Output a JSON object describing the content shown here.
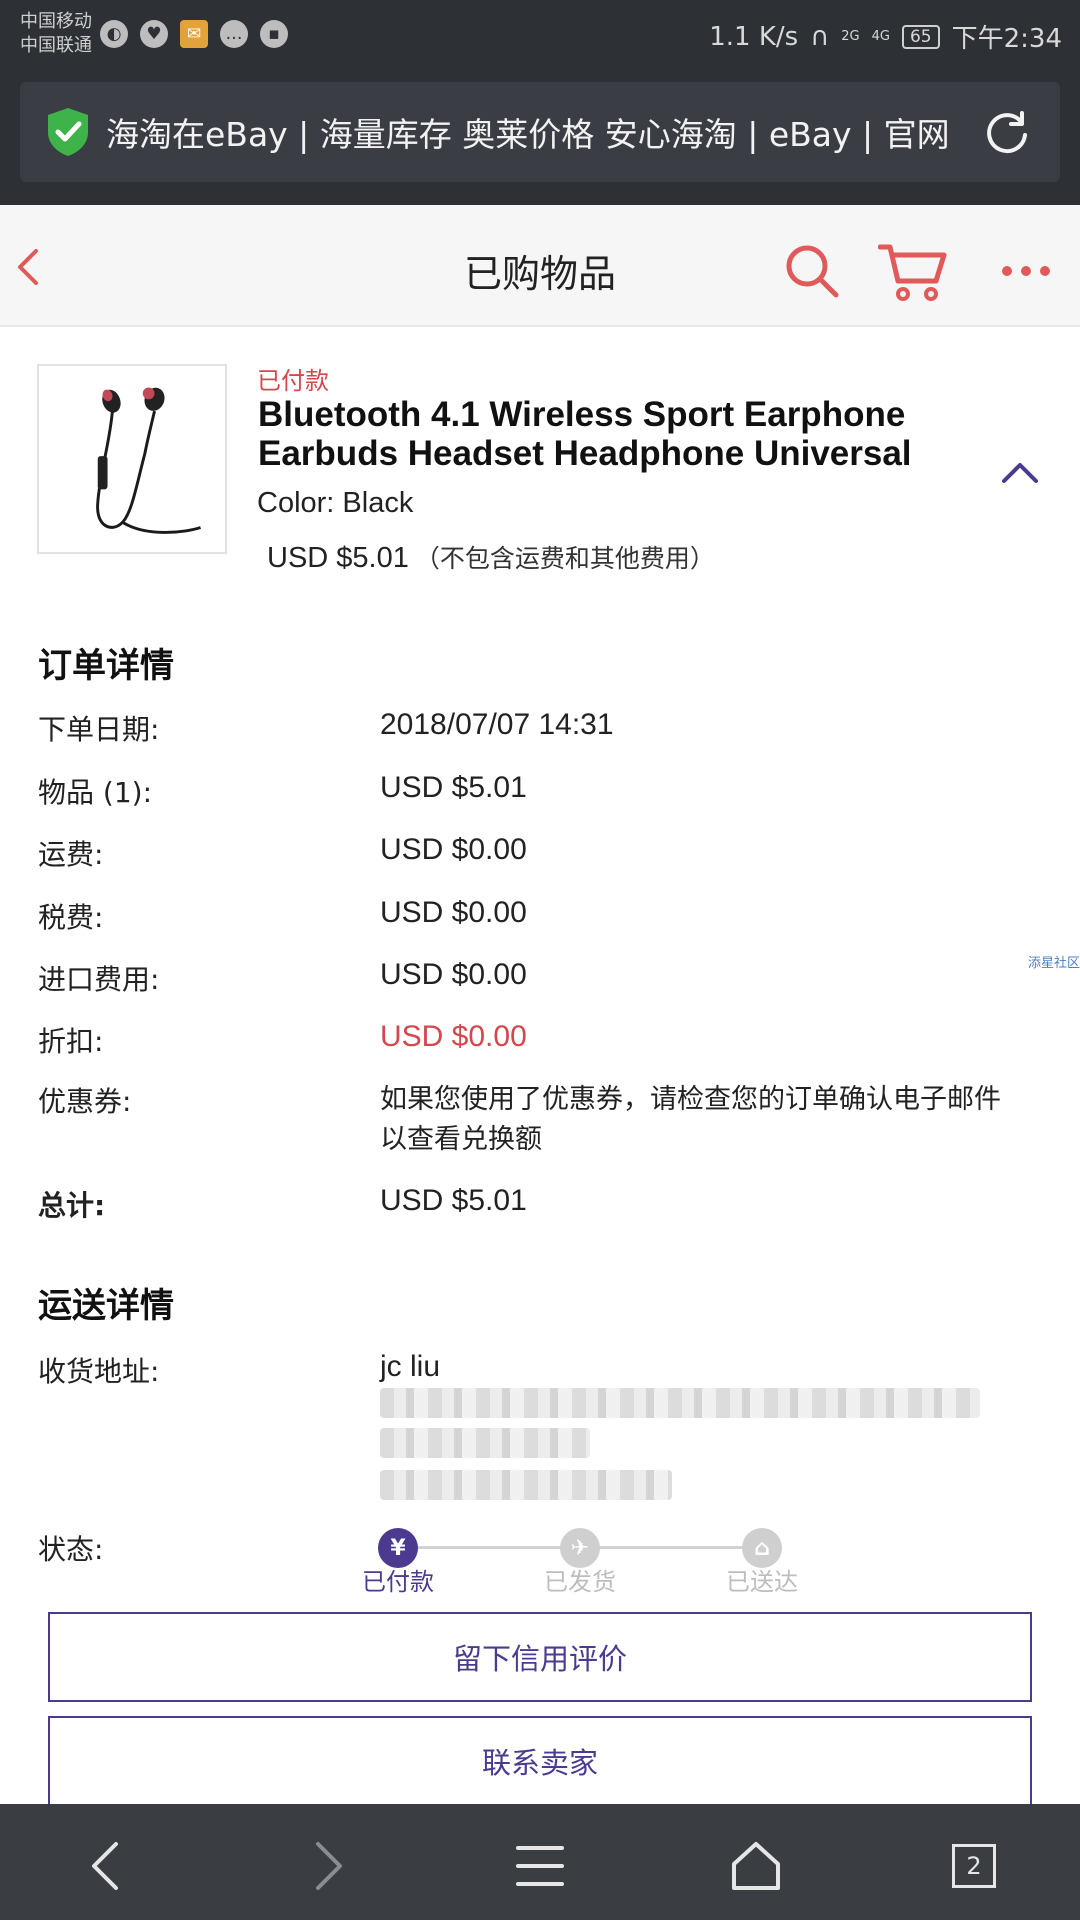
{
  "status_bar": {
    "carrier_1": "中国移动",
    "carrier_2": "中国联通",
    "speed": "1.1 K/s",
    "net_2g": "2G",
    "net_4g": "4G",
    "battery": "65",
    "time": "下午2:34"
  },
  "banner": {
    "title": "海淘在eBay | 海量库存 奥莱价格 安心海淘 | eBay | 官网"
  },
  "header": {
    "title": "已购物品"
  },
  "product": {
    "status": "已付款",
    "title": "Bluetooth 4.1 Wireless Sport Earphone Earbuds Headset Headphone Universal",
    "color": "Color: Black",
    "price": "USD $5.01",
    "price_note": "（不包含运费和其他费用）"
  },
  "order_details": {
    "heading": "订单详情",
    "rows": [
      {
        "label": "下单日期:",
        "value": "2018/07/07 14:31"
      },
      {
        "label": "物品 (1):",
        "value": "USD $5.01"
      },
      {
        "label": "运费:",
        "value": "USD $0.00"
      },
      {
        "label": "税费:",
        "value": "USD $0.00"
      },
      {
        "label": "进口费用:",
        "value": "USD $0.00"
      },
      {
        "label": "折扣:",
        "value": "USD $0.00"
      },
      {
        "label": "优惠券:",
        "value": "如果您使用了优惠券，请检查您的订单确认电子邮件以查看兑换额"
      },
      {
        "label": "总计:",
        "value": "USD $5.01"
      }
    ]
  },
  "watermark": "添星社区",
  "shipping": {
    "heading": "运送详情",
    "address_label": "收货地址:",
    "recipient": "jc liu",
    "status_label": "状态:",
    "steps": [
      {
        "label": "已付款",
        "icon": "yen-icon",
        "glyph": "¥",
        "done": true
      },
      {
        "label": "已发货",
        "icon": "plane-icon",
        "glyph": "✈",
        "done": false
      },
      {
        "label": "已送达",
        "icon": "home-icon",
        "glyph": "⌂",
        "done": false
      }
    ]
  },
  "actions": {
    "feedback": "留下信用评价",
    "contact": "联系卖家"
  },
  "bottom_nav": {
    "tab_count": "2"
  },
  "colors": {
    "accent": "#4b3a8f",
    "red": "#d4474d",
    "ebay_red": "#e05a5a"
  }
}
